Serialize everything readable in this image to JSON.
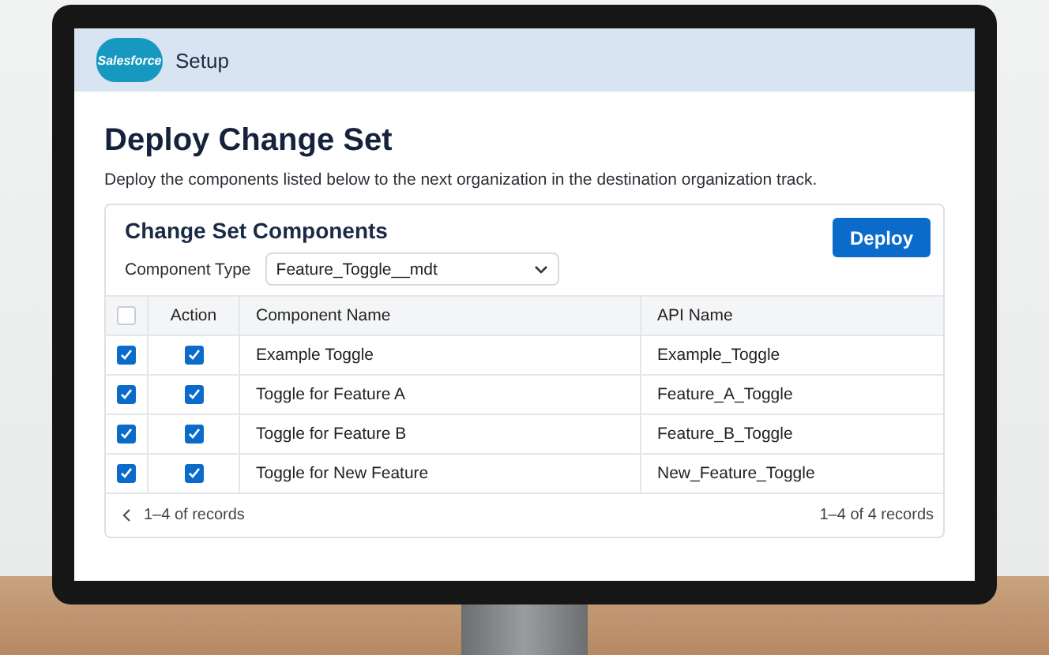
{
  "header": {
    "logo": "Salesforce",
    "title": "Setup"
  },
  "page": {
    "title": "Deploy Change Set",
    "description": "Deploy the components listed below to the next organization in the destination organization track."
  },
  "card": {
    "title": "Change Set Components",
    "deploy_button": "Deploy",
    "filter_label": "Component Type",
    "filter_value": "Feature_Toggle__mdt"
  },
  "table": {
    "select_all_checked": false,
    "columns": [
      "Action",
      "Component Name",
      "API Name"
    ],
    "rows": [
      {
        "selected": true,
        "action_checked": true,
        "name": "Example Toggle",
        "api_name": "Example_Toggle"
      },
      {
        "selected": true,
        "action_checked": true,
        "name": "Toggle for Feature A",
        "api_name": "Feature_A_Toggle"
      },
      {
        "selected": true,
        "action_checked": true,
        "name": "Toggle for Feature B",
        "api_name": "Feature_B_Toggle"
      },
      {
        "selected": true,
        "action_checked": true,
        "name": "Toggle for New Feature",
        "api_name": "New_Feature_Toggle"
      }
    ]
  },
  "footer": {
    "left": "1–4 of records",
    "right": "1–4 of 4 records"
  }
}
